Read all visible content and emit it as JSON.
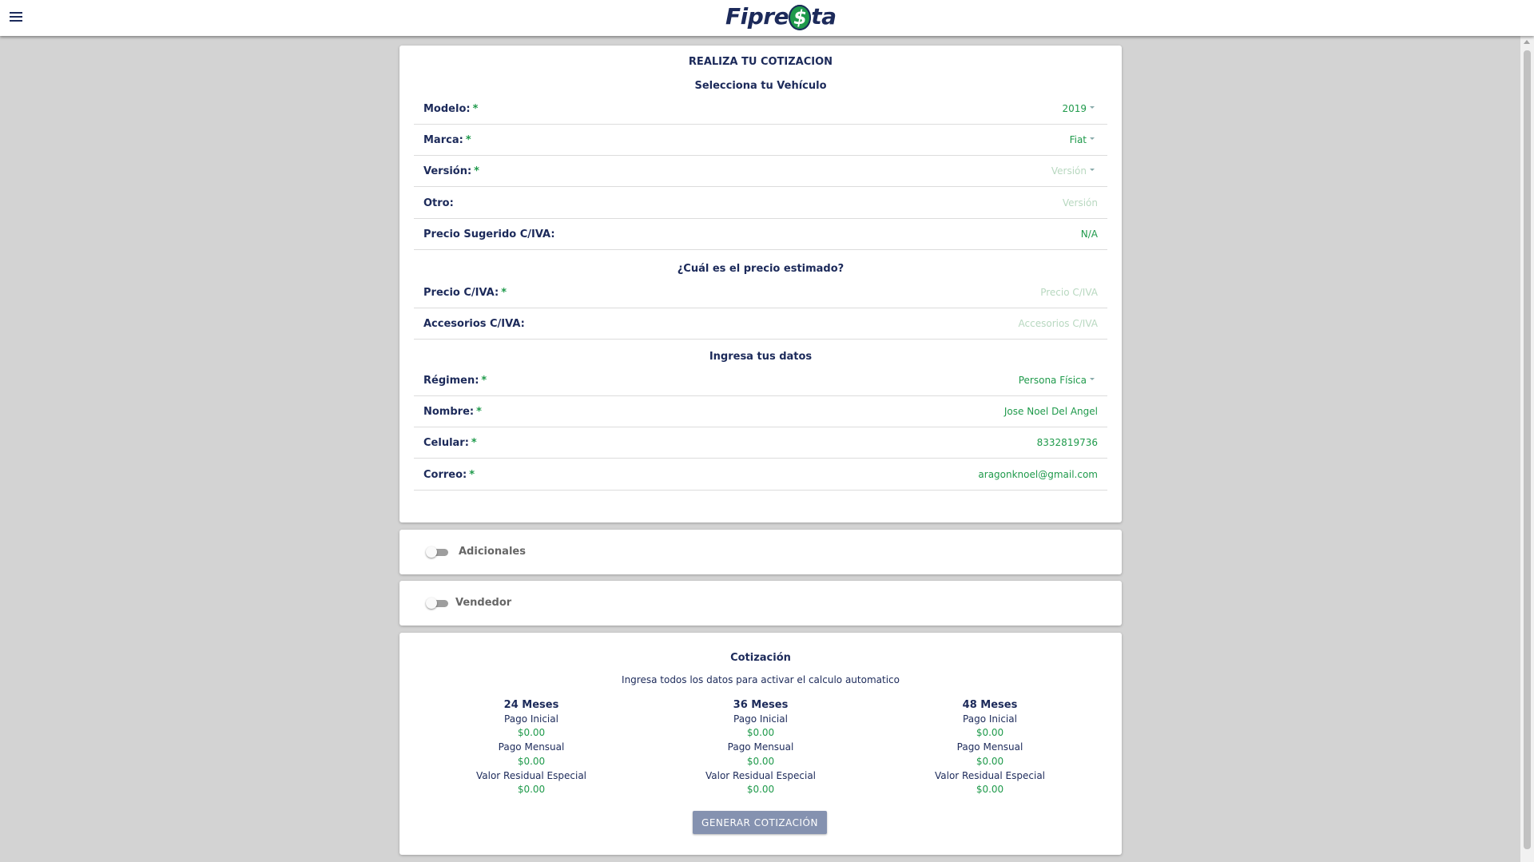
{
  "header": {
    "logo_text_pre": "Fipre",
    "logo_text_s": "$",
    "logo_text_post": "ta"
  },
  "form": {
    "title": "REALIZA TU COTIZACION",
    "vehicle_section": "Selecciona tu Vehículo",
    "fields": {
      "modelo": {
        "label": "Modelo:",
        "required": "*",
        "value": "2019"
      },
      "marca": {
        "label": "Marca:",
        "required": "*",
        "value": "Fiat"
      },
      "version": {
        "label": "Versión:",
        "required": "*",
        "placeholder": "Versión"
      },
      "otro": {
        "label": "Otro:",
        "placeholder": "Versión"
      },
      "precio_sugerido": {
        "label": "Precio Sugerido C/IVA:",
        "value": "N/A"
      }
    },
    "price_section": "¿Cuál es el precio estimado?",
    "price_fields": {
      "precio": {
        "label": "Precio C/IVA:",
        "required": "*",
        "placeholder": "Precio C/IVA"
      },
      "accesorios": {
        "label": "Accesorios C/IVA:",
        "placeholder": "Accesorios C/IVA"
      }
    },
    "data_section": "Ingresa tus datos",
    "data_fields": {
      "regimen": {
        "label": "Régimen:",
        "required": "*",
        "value": "Persona Física"
      },
      "nombre": {
        "label": "Nombre:",
        "required": "*",
        "value": "Jose Noel Del Angel"
      },
      "celular": {
        "label": "Celular:",
        "required": "*",
        "value": "8332819736"
      },
      "correo": {
        "label": "Correo:",
        "required": "*",
        "value": "aragonknoel@gmail.com"
      }
    }
  },
  "toggles": {
    "adicionales": {
      "label": "Adicionales",
      "on": false
    },
    "vendedor": {
      "label": "Vendedor",
      "on": false
    }
  },
  "cotizacion": {
    "title": "Cotización",
    "subtitle": "Ingresa todos los datos para activar el calculo automatico",
    "terms": [
      {
        "head": "24 Meses",
        "pago_inicial_label": "Pago Inicial",
        "pago_inicial": "$0.00",
        "pago_mensual_label": "Pago Mensual",
        "pago_mensual": "$0.00",
        "residual_label": "Valor Residual Especial",
        "residual": "$0.00"
      },
      {
        "head": "36 Meses",
        "pago_inicial_label": "Pago Inicial",
        "pago_inicial": "$0.00",
        "pago_mensual_label": "Pago Mensual",
        "pago_mensual": "$0.00",
        "residual_label": "Valor Residual Especial",
        "residual": "$0.00"
      },
      {
        "head": "48 Meses",
        "pago_inicial_label": "Pago Inicial",
        "pago_inicial": "$0.00",
        "pago_mensual_label": "Pago Mensual",
        "pago_mensual": "$0.00",
        "residual_label": "Valor Residual Especial",
        "residual": "$0.00"
      }
    ],
    "button_label": "GENERAR COTIZACIÓN"
  },
  "colors": {
    "navy": "#1c2a5a",
    "green": "#1f9a4b",
    "background": "#d3d3d3",
    "button": "#8592b0"
  }
}
